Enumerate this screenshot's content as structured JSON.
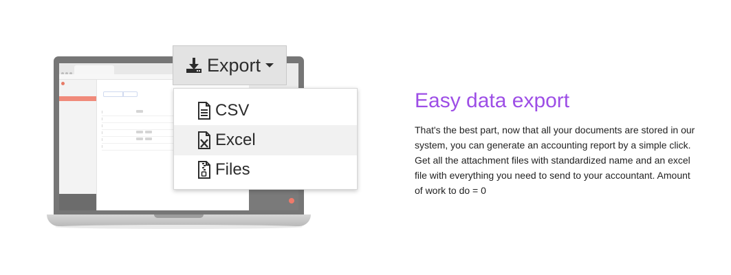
{
  "export": {
    "button_label": "Export",
    "menu": [
      {
        "label": "CSV",
        "icon": "csv-file-icon"
      },
      {
        "label": "Excel",
        "icon": "excel-file-icon"
      },
      {
        "label": "Files",
        "icon": "zip-file-icon"
      }
    ]
  },
  "feature": {
    "title": "Easy data export",
    "description": "That's the best part, now that all your documents are stored in our system, you can generate an accounting report by a simple click. Get all the attachment files with standardized name and an excel file with everything you need to send to your accountant. Amount of work to do = 0"
  },
  "colors": {
    "title": "#9d4ee6",
    "accent": "#f08a7a"
  }
}
